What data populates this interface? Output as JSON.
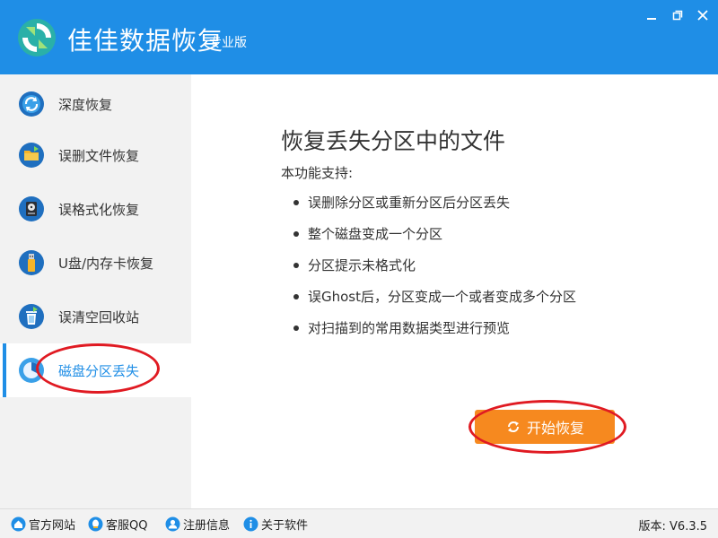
{
  "app": {
    "title": "佳佳数据恢复",
    "edition": "专业版"
  },
  "window_controls": {
    "minimize": "minimize-icon",
    "maximize": "restore-icon",
    "close": "close-icon"
  },
  "sidebar": {
    "items": [
      {
        "label": "深度恢复",
        "icon": "refresh-circle-icon"
      },
      {
        "label": "误删文件恢复",
        "icon": "folder-icon"
      },
      {
        "label": "误格式化恢复",
        "icon": "hard-disk-icon"
      },
      {
        "label": "U盘/内存卡恢复",
        "icon": "usb-drive-icon"
      },
      {
        "label": "误清空回收站",
        "icon": "recycle-bin-icon"
      },
      {
        "label": "磁盘分区丢失",
        "icon": "partition-icon",
        "active": true
      }
    ]
  },
  "main": {
    "title": "恢复丢失分区中的文件",
    "subtitle": "本功能支持:",
    "features": [
      "误删除分区或重新分区后分区丢失",
      "整个磁盘变成一个分区",
      "分区提示未格式化",
      "误Ghost后，分区变成一个或者变成多个分区",
      "对扫描到的常用数据类型进行预览"
    ],
    "start_button": "开始恢复"
  },
  "footer": {
    "links": [
      {
        "label": "官方网站",
        "icon": "home-icon"
      },
      {
        "label": "客服QQ",
        "icon": "qq-icon"
      },
      {
        "label": "注册信息",
        "icon": "user-icon"
      },
      {
        "label": "关于软件",
        "icon": "info-icon"
      }
    ],
    "version": "版本: V6.3.5"
  },
  "colors": {
    "accent": "#1f8ee6",
    "button": "#f6891f",
    "annotation": "#e01a22"
  }
}
